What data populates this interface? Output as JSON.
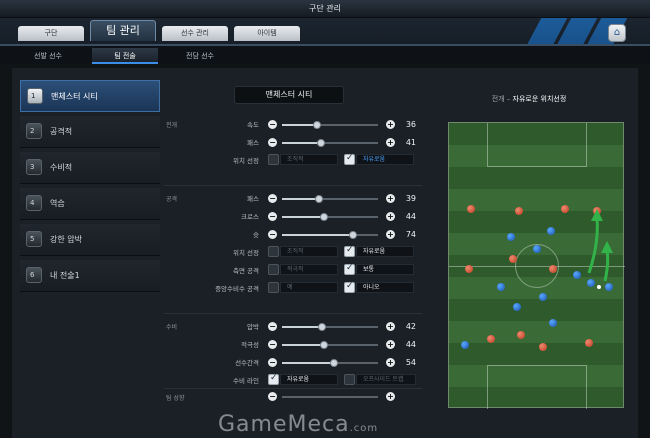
{
  "window": {
    "title": "구단 관리"
  },
  "top_tabs": [
    {
      "label": "구단",
      "active": false
    },
    {
      "label": "팀 관리",
      "active": true
    },
    {
      "label": "선수 관리",
      "active": false
    },
    {
      "label": "아이템",
      "active": false
    }
  ],
  "sub_tabs": [
    {
      "label": "선발 선수",
      "active": false
    },
    {
      "label": "팀 전술",
      "active": true
    },
    {
      "label": "전담 선수",
      "active": false
    }
  ],
  "tactics": [
    {
      "num": "1",
      "label": "맨체스터 시티",
      "active": true
    },
    {
      "num": "2",
      "label": "공격적",
      "active": false
    },
    {
      "num": "3",
      "label": "수비적",
      "active": false
    },
    {
      "num": "4",
      "label": "역습",
      "active": false
    },
    {
      "num": "5",
      "label": "강한 압박",
      "active": false
    },
    {
      "num": "6",
      "label": "내 전술1",
      "active": false
    }
  ],
  "team_name": "맨체스터 시티",
  "sections": {
    "buildup": {
      "label": "전개",
      "speed": {
        "label": "속도",
        "value": 36
      },
      "passing": {
        "label": "패스",
        "value": 41
      },
      "positioning": {
        "label": "위치 선정",
        "option1": "조직적",
        "option2": "자유로움",
        "selected": 2
      }
    },
    "attack": {
      "label": "공격",
      "passing": {
        "label": "패스",
        "value": 39
      },
      "crossing": {
        "label": "크로스",
        "value": 44
      },
      "shooting": {
        "label": "슛",
        "value": 74
      },
      "positioning": {
        "label": "위치 선정",
        "option1": "조직적",
        "option2": "자유로움",
        "selected": 2
      },
      "side_attack": {
        "label": "측면 공격",
        "option1": "적극적",
        "option2": "보통",
        "selected": 2
      },
      "center_back_attack": {
        "label": "중앙수비수 공격",
        "option1": "예",
        "option2": "아니오",
        "selected": 2
      }
    },
    "defense": {
      "label": "수비",
      "pressure": {
        "label": "압박",
        "value": 42
      },
      "aggression": {
        "label": "적극성",
        "value": 44
      },
      "width": {
        "label": "선수간격",
        "value": 54
      },
      "line": {
        "label": "수비 라인",
        "option1": "자유로움",
        "option2": "오프사이드 트랩",
        "selected": 1
      }
    },
    "team_style": {
      "label": "팀 성향"
    }
  },
  "pitch": {
    "title_prefix": "전개 –",
    "title_main": "자유로운 위치선정",
    "colors": {
      "home": "#b8391f",
      "away": "#164fa8"
    }
  },
  "watermark": {
    "main": "GameMeca",
    "suffix": ".com"
  }
}
